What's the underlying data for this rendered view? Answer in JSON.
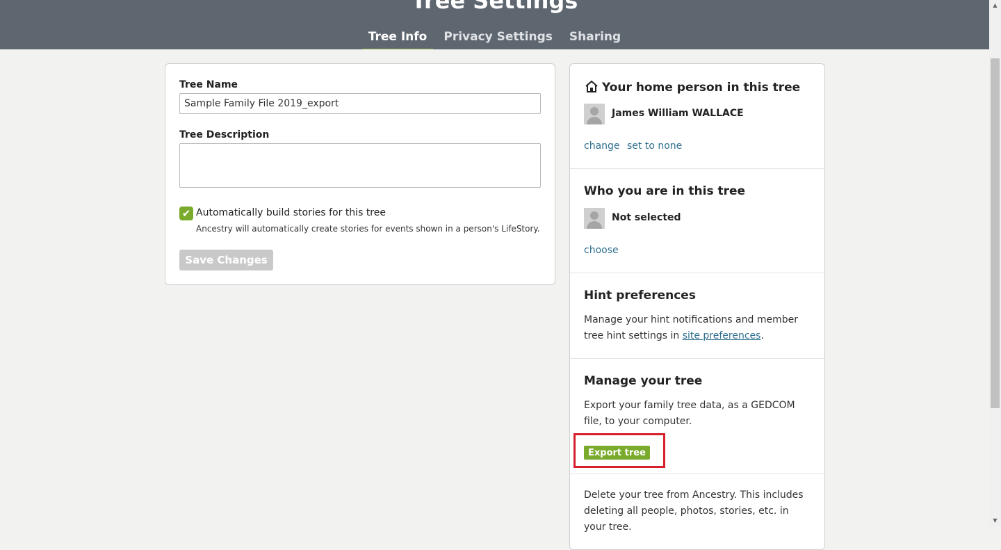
{
  "header": {
    "title": "Tree Settings",
    "tabs": [
      {
        "label": "Tree Info",
        "active": true
      },
      {
        "label": "Privacy Settings",
        "active": false
      },
      {
        "label": "Sharing",
        "active": false
      }
    ]
  },
  "tree_info": {
    "name_label": "Tree Name",
    "name_value": "Sample Family File 2019_export",
    "description_label": "Tree Description",
    "description_value": "",
    "auto_stories_checked": true,
    "auto_stories_label": "Automatically build stories for this tree",
    "auto_stories_help": "Ancestry will automatically create stories for events shown in a person's LifeStory.",
    "save_label": "Save Changes"
  },
  "home_person": {
    "title": "Your home person in this tree",
    "name": "James William WALLACE",
    "change_label": "change",
    "set_none_label": "set to none"
  },
  "who_you_are": {
    "title": "Who you are in this tree",
    "name": "Not selected",
    "choose_label": "choose"
  },
  "hint_prefs": {
    "title": "Hint preferences",
    "text_before": "Manage your hint notifications and member tree hint settings in ",
    "link": "site preferences",
    "text_after": "."
  },
  "manage_tree": {
    "title": "Manage your tree",
    "text": "Export your family tree data, as a GEDCOM file, to your computer.",
    "export_label": "Export tree",
    "delete_text": "Delete your tree from Ancestry. This includes deleting all people, photos, stories, etc. in your tree."
  },
  "icons": {
    "home": "home-icon",
    "avatar": "person-silhouette-icon",
    "checkbox": "checkmark-icon"
  },
  "colors": {
    "header_bg": "#5e6670",
    "accent_green": "#7aab2c",
    "link": "#2f6f8f",
    "highlight_red": "#d7202c"
  }
}
